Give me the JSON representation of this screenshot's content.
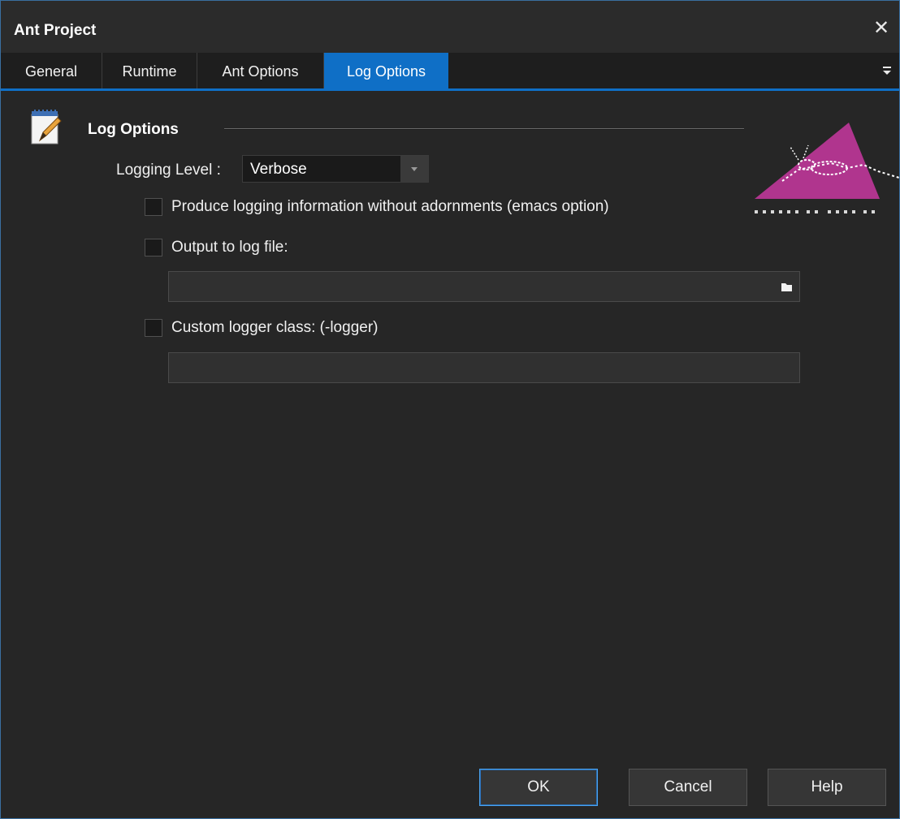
{
  "window": {
    "title": "Ant Project"
  },
  "tabs": [
    {
      "label": "General",
      "active": false
    },
    {
      "label": "Runtime",
      "active": false
    },
    {
      "label": "Ant Options",
      "active": false
    },
    {
      "label": "Log Options",
      "active": true
    }
  ],
  "section": {
    "title": "Log Options"
  },
  "logging_level": {
    "label": "Logging Level :",
    "value": "Verbose"
  },
  "options": {
    "emacs": {
      "label": "Produce logging information without adornments (emacs option)",
      "checked": false
    },
    "log_file": {
      "label": "Output to log file:",
      "checked": false,
      "value": ""
    },
    "custom_logger": {
      "label": "Custom logger class: (-logger)",
      "checked": false,
      "value": ""
    }
  },
  "buttons": {
    "ok": "OK",
    "cancel": "Cancel",
    "help": "Help"
  },
  "colors": {
    "accent": "#0f6fc6",
    "background": "#262626",
    "logo": "#b0358e"
  },
  "icons": [
    "close-icon",
    "tab-menu-icon",
    "notepad-edit-icon",
    "ant-logo",
    "folder-icon",
    "dropdown-arrow-icon"
  ]
}
